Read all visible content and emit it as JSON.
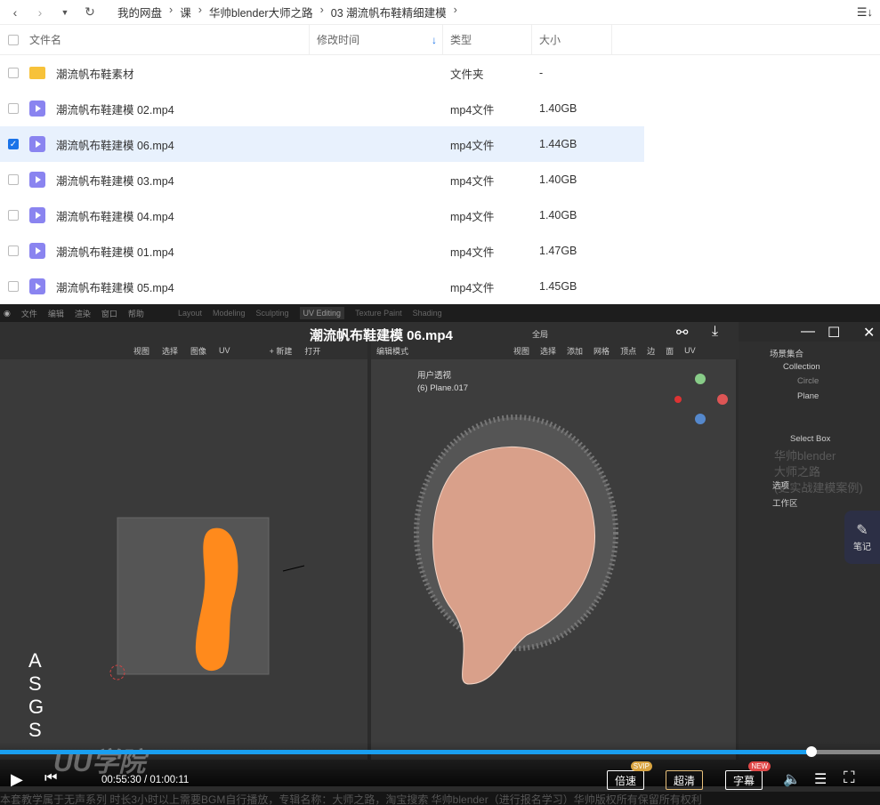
{
  "breadcrumb": [
    "我的网盘",
    "课",
    "华帅blender大师之路",
    "03 潮流帆布鞋精细建模"
  ],
  "columns": {
    "name": "文件名",
    "time": "修改时间",
    "type": "类型",
    "size": "大小"
  },
  "files": [
    {
      "name": "潮流帆布鞋素材",
      "type": "文件夹",
      "size": "-",
      "icon": "folder-icon",
      "selected": false
    },
    {
      "name": "潮流帆布鞋建模 02.mp4",
      "type": "mp4文件",
      "size": "1.40GB",
      "icon": "video-icon",
      "selected": false
    },
    {
      "name": "潮流帆布鞋建模 06.mp4",
      "type": "mp4文件",
      "size": "1.44GB",
      "icon": "video-icon",
      "selected": true
    },
    {
      "name": "潮流帆布鞋建模 03.mp4",
      "type": "mp4文件",
      "size": "1.40GB",
      "icon": "video-icon",
      "selected": false
    },
    {
      "name": "潮流帆布鞋建模 04.mp4",
      "type": "mp4文件",
      "size": "1.40GB",
      "icon": "video-icon",
      "selected": false
    },
    {
      "name": "潮流帆布鞋建模 01.mp4",
      "type": "mp4文件",
      "size": "1.47GB",
      "icon": "video-icon",
      "selected": false
    },
    {
      "name": "潮流帆布鞋建模 05.mp4",
      "type": "mp4文件",
      "size": "1.45GB",
      "icon": "video-icon",
      "selected": false
    }
  ],
  "player": {
    "title": "潮流帆布鞋建模 06.mp4",
    "current_time": "00:55:30",
    "total_time": "01:00:11",
    "progress_percent": 92.2,
    "speed_label": "倍速",
    "speed_badge": "SVIP",
    "quality_label": "超清",
    "subtitle_label": "字幕",
    "subtitle_badge": "NEW",
    "note_label": "笔记",
    "watermark": "UU学院",
    "caption": "本套教学属于无声系列 时长3小时以上需要BGM自行播放，专辑名称：大师之路，淘宝搜索 华帅blender（进行报名学习）华帅版权所有保留所有权利"
  },
  "blender": {
    "menu": [
      "文件",
      "编辑",
      "渲染",
      "窗口",
      "帮助"
    ],
    "workspaces": [
      "Layout",
      "Modeling",
      "Sculpting",
      "UV Editing",
      "Texture Paint",
      "Shading"
    ],
    "active_workspace": "UV Editing",
    "uv_menu": [
      "视图",
      "选择",
      "图像",
      "UV"
    ],
    "uv_new": "+ 新建",
    "uv_open": "打开",
    "mode": "编辑模式",
    "view_menu": [
      "视图",
      "选择",
      "添加",
      "网格",
      "顶点",
      "边",
      "面",
      "UV"
    ],
    "transform": "全局",
    "viewport_label": "用户透视",
    "object_label": "(6) Plane.017",
    "outliner": {
      "scene": "场景集合",
      "collection": "Collection",
      "items": [
        "Circle",
        "Plane"
      ]
    },
    "tool_name": "Select Box",
    "sections": [
      "选项",
      "工作区"
    ],
    "keys": [
      "A",
      "S",
      "G",
      "S"
    ],
    "overlay_watermark": [
      "华帅blender",
      "大师之路",
      "(更实战建模案例)"
    ]
  },
  "colors": {
    "accent": "#1a9ff0",
    "selected_row": "#e8f1fd",
    "uv_island": "#ff8a1c",
    "mesh": "#d9a08a"
  }
}
